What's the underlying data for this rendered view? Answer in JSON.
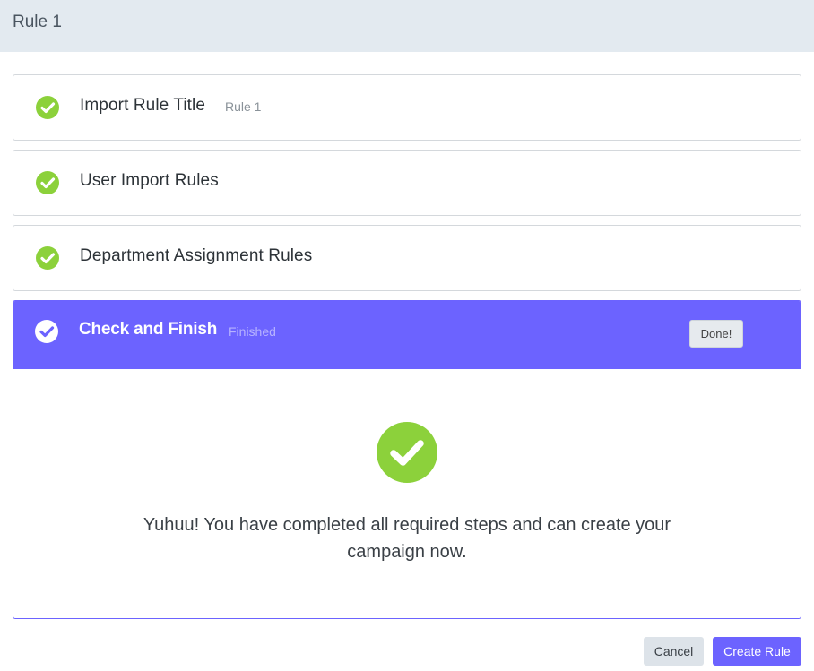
{
  "header": {
    "title": "Rule 1"
  },
  "steps": [
    {
      "title": "Import Rule Title",
      "subtitle": "Rule 1",
      "status": "complete"
    },
    {
      "title": "User Import Rules",
      "subtitle": "",
      "status": "complete"
    },
    {
      "title": "Department Assignment Rules",
      "subtitle": "",
      "status": "complete"
    }
  ],
  "active_step": {
    "title": "Check and Finish",
    "subtitle": "Finished",
    "done_label": "Done!",
    "message": "Yuhuu! You have completed all required steps and can create your campaign now."
  },
  "footer": {
    "cancel_label": "Cancel",
    "create_label": "Create Rule"
  },
  "colors": {
    "accent": "#6c63ff",
    "success": "#8cd13b",
    "header_bg": "#e3eaf0"
  },
  "icons": {
    "step_complete": "check-circle-icon",
    "finish": "check-circle-icon"
  }
}
